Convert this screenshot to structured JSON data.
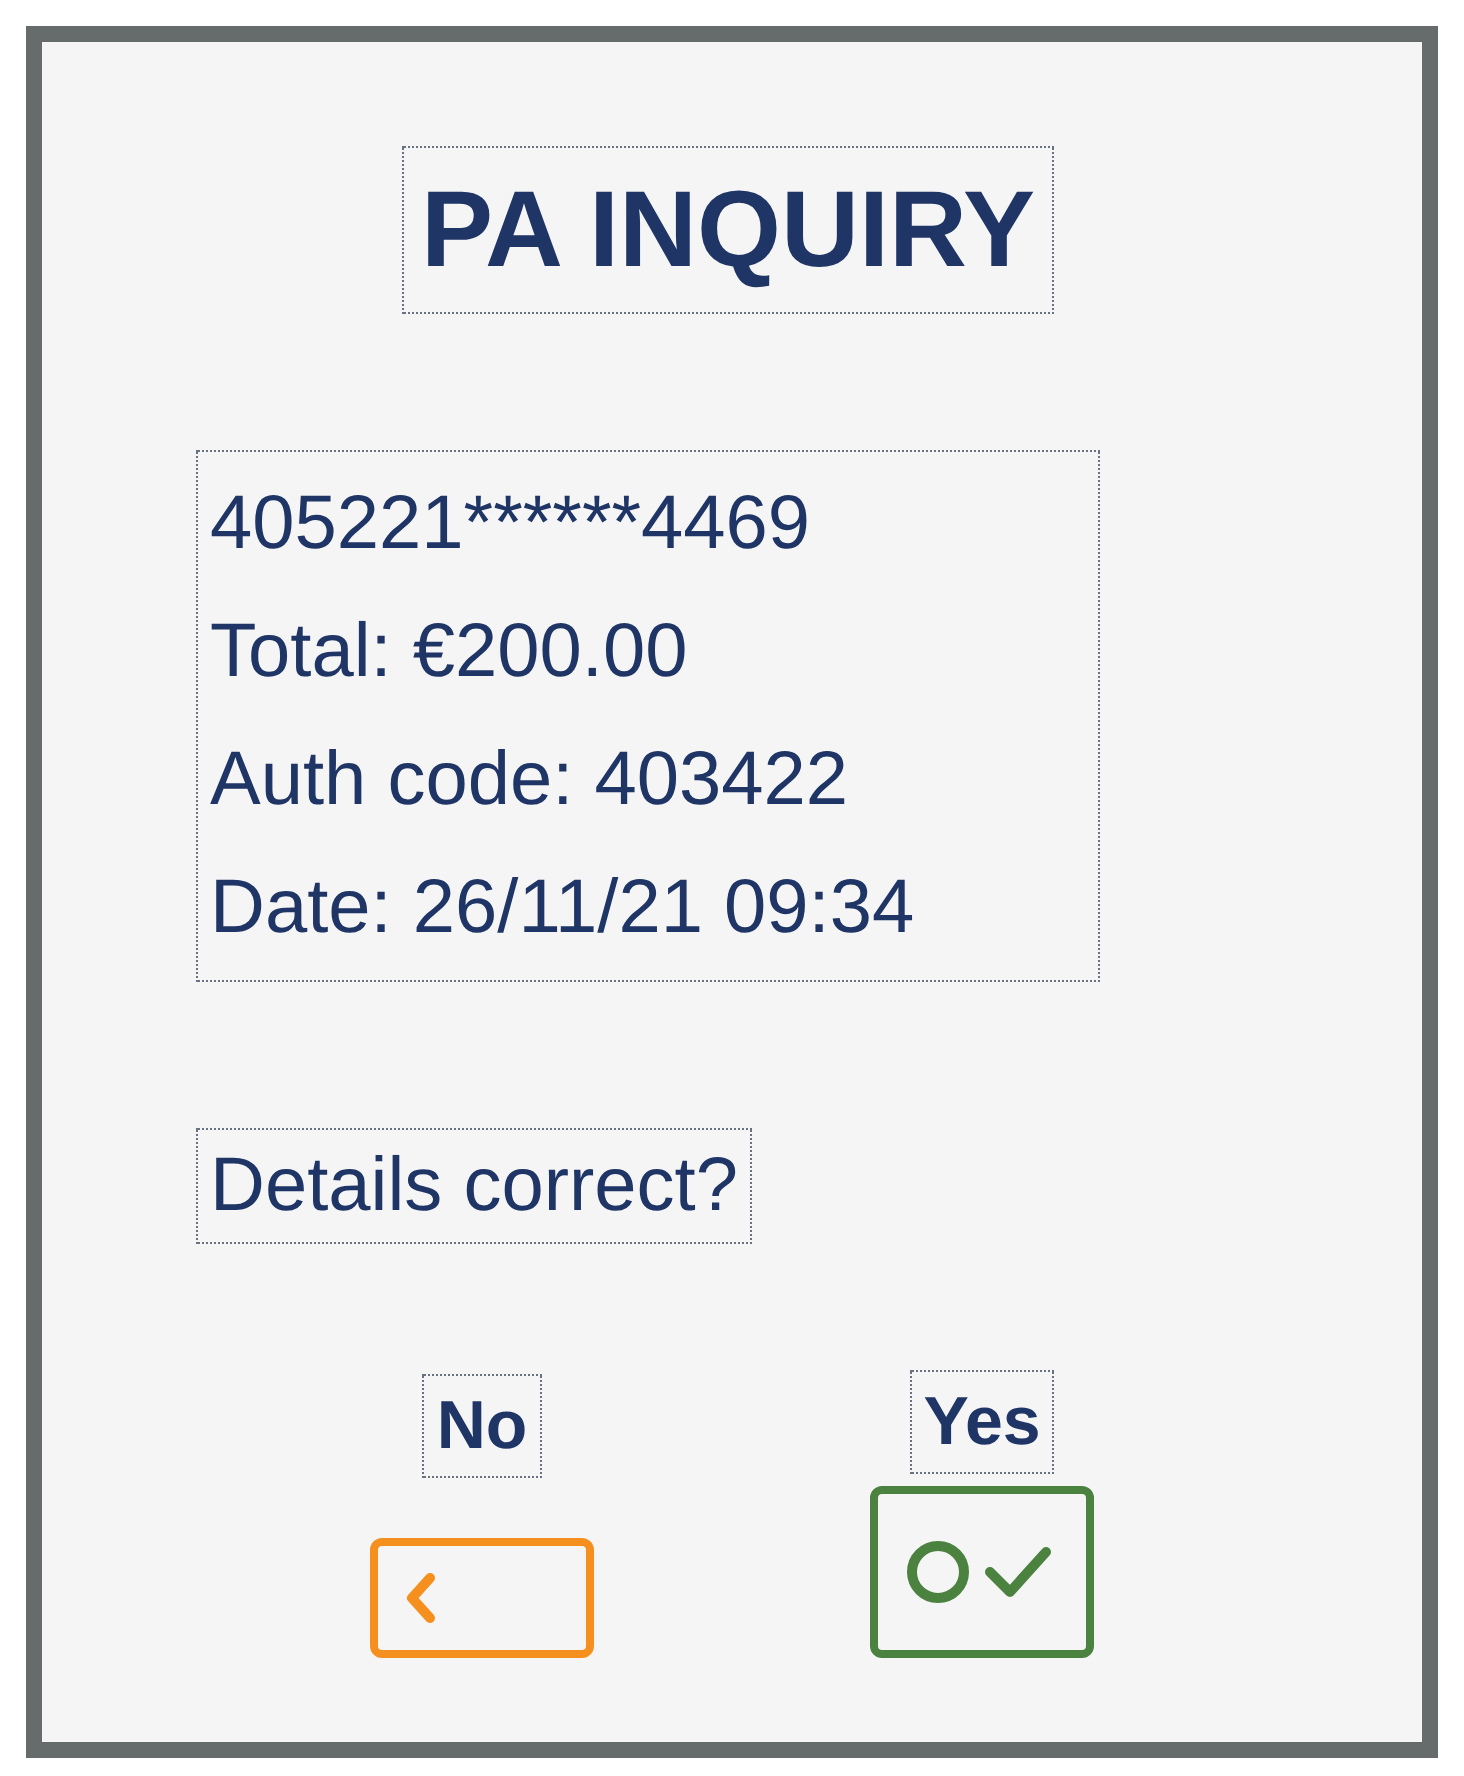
{
  "title": "PA INQUIRY",
  "details": [
    "405221******4469",
    "Total: €200.00",
    "Auth code: 403422",
    "Date: 26/11/21 09:34"
  ],
  "prompt": "Details correct?",
  "buttons": [
    {
      "label": "No",
      "kind": "back"
    },
    {
      "label": "Yes",
      "kind": "confirm"
    }
  ]
}
